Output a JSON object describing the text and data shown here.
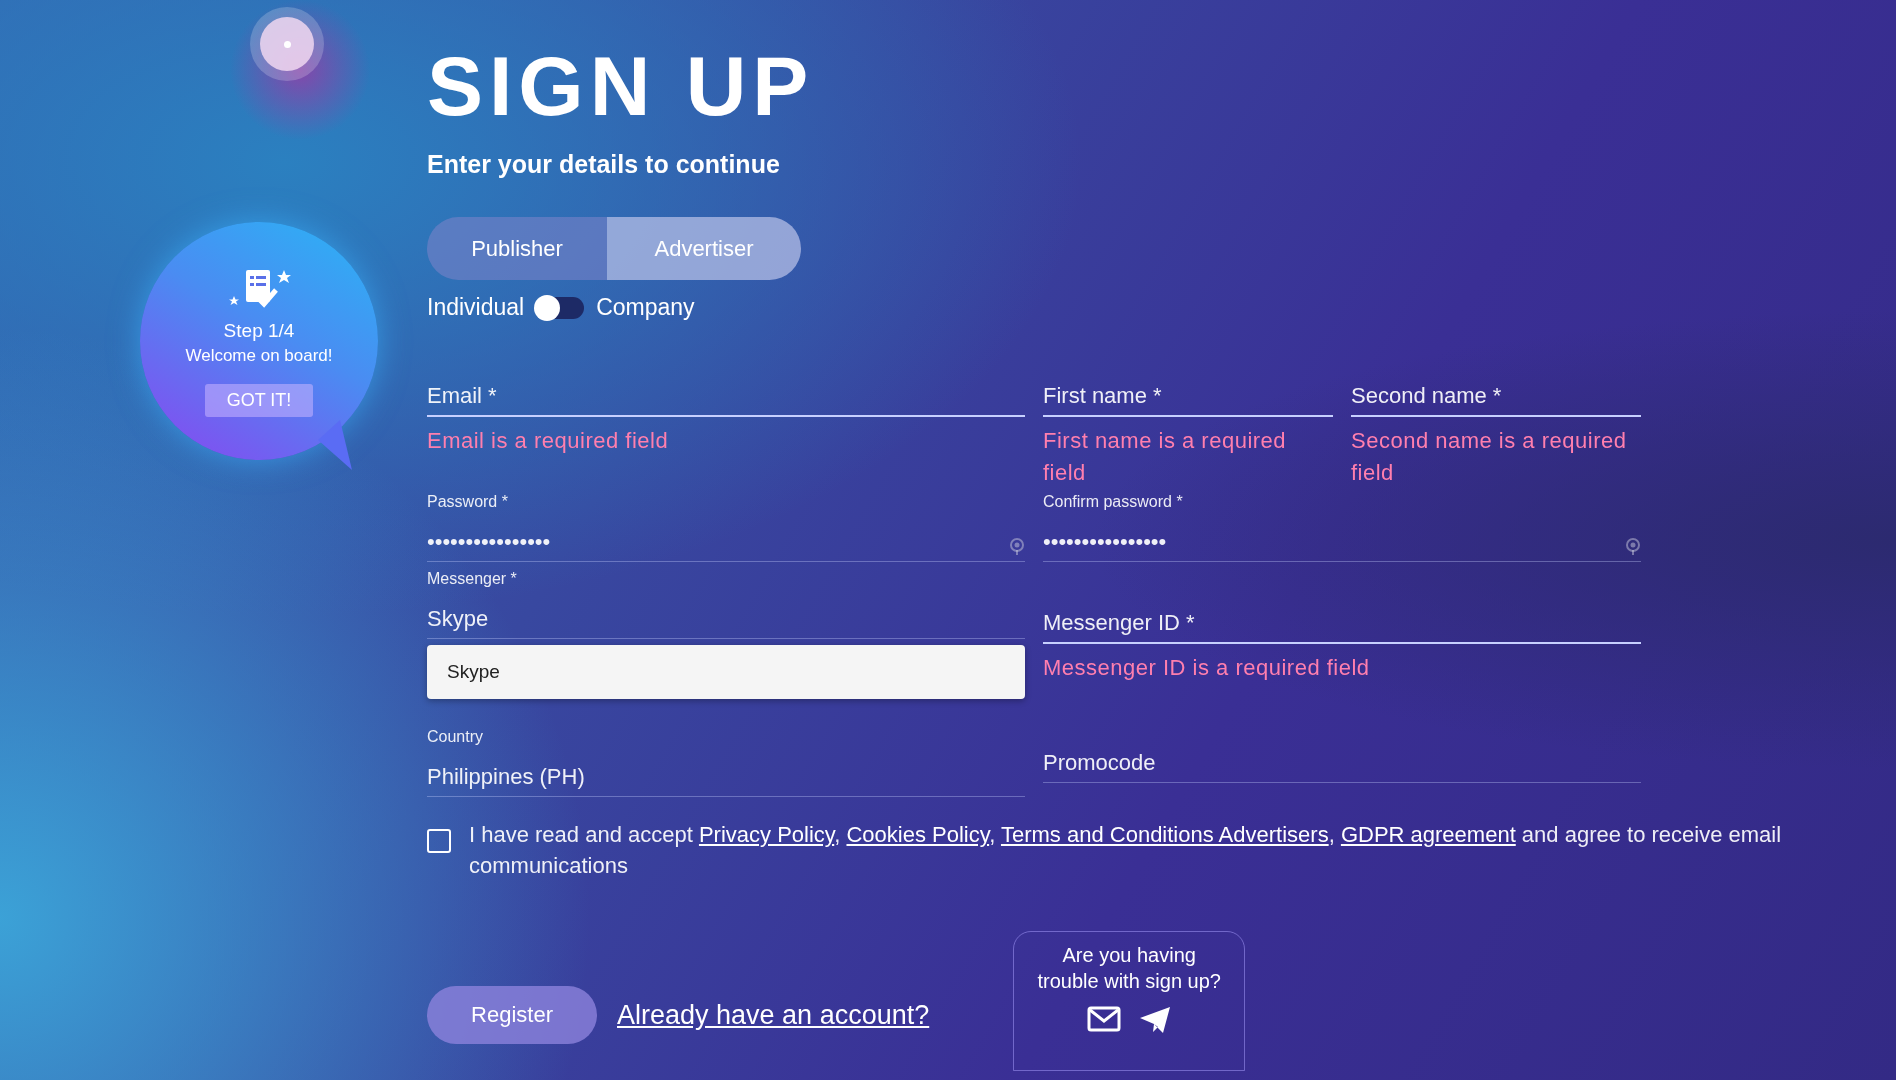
{
  "title": "SIGN UP",
  "subtitle": "Enter your details to continue",
  "role_tabs": [
    {
      "label": "Publisher",
      "selected": false
    },
    {
      "label": "Advertiser",
      "selected": true
    }
  ],
  "entity_toggle": {
    "left_label": "Individual",
    "right_label": "Company",
    "on": false
  },
  "email": {
    "label": "Email *",
    "error": "Email is a required field"
  },
  "first_name": {
    "label": "First name *",
    "error": "First name is a required field"
  },
  "second_name": {
    "label": "Second name *",
    "error": "Second name is a required field"
  },
  "password": {
    "label": "Password *",
    "value": "••••••••••••••••"
  },
  "confirm_password": {
    "label": "Confirm password *",
    "value": "••••••••••••••••"
  },
  "messenger": {
    "label": "Messenger *",
    "value": "Skype"
  },
  "messenger_dropdown": {
    "options": [
      "Skype"
    ]
  },
  "messenger_id": {
    "label": "Messenger ID *",
    "error": "Messenger ID is a required field"
  },
  "country": {
    "label": "Country",
    "value": "Philippines (PH)"
  },
  "promocode": {
    "label": "Promocode"
  },
  "consent": {
    "checked": false,
    "segments": [
      {
        "kind": "text",
        "text": "I have read and accept "
      },
      {
        "kind": "link",
        "text": "Privacy Policy"
      },
      {
        "kind": "text",
        "text": ", "
      },
      {
        "kind": "link",
        "text": "Cookies Policy"
      },
      {
        "kind": "text",
        "text": ", "
      },
      {
        "kind": "link",
        "text": "Terms and Conditions Advertisers"
      },
      {
        "kind": "text",
        "text": ", "
      },
      {
        "kind": "link",
        "text": "GDPR agreement"
      },
      {
        "kind": "text",
        "text": " and agree to receive email communications"
      }
    ]
  },
  "register_button": "Register",
  "login_link": "Already have an account?",
  "help_box": {
    "text": "Are you having trouble with sign up?"
  },
  "onboarding": {
    "step": "Step 1/4",
    "message": "Welcome on board!",
    "button": "GOT IT!"
  }
}
